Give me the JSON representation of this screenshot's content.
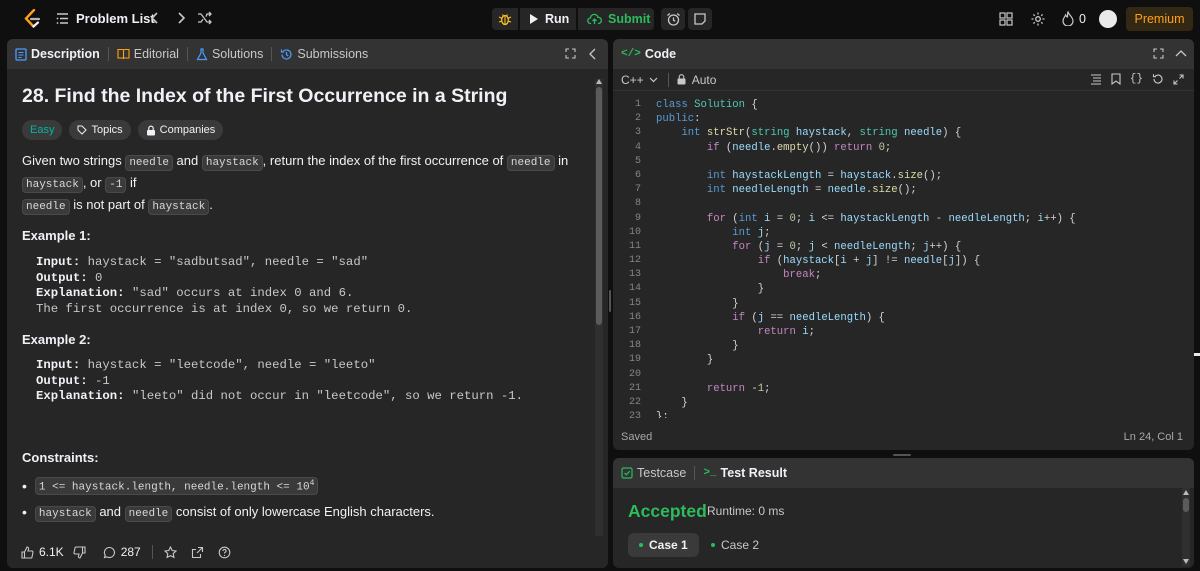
{
  "topbar": {
    "problem_list": "Problem List",
    "run": "Run",
    "submit": "Submit",
    "streak_count": "0",
    "premium": "Premium"
  },
  "left_tabs": {
    "description": "Description",
    "editorial": "Editorial",
    "solutions": "Solutions",
    "submissions": "Submissions"
  },
  "problem": {
    "title": "28. Find the Index of the First Occurrence in a String",
    "difficulty": "Easy",
    "topics": "Topics",
    "companies": "Companies",
    "desc_1": "Given two strings ",
    "needle": "needle",
    "and": " and ",
    "haystack": "haystack",
    "desc_2": ", return the index of the first occurrence of ",
    "in": " in ",
    "or": ", or ",
    "neg1": "-1",
    "if": " if",
    "is_not_part_of": " is not part of ",
    "period": ".",
    "example1_title": "Example 1:",
    "ex1_input_label": "Input:",
    "ex1_input": " haystack = \"sadbutsad\", needle = \"sad\"",
    "ex1_output_label": "Output:",
    "ex1_output": " 0",
    "ex1_expl_label": "Explanation:",
    "ex1_expl_1": " \"sad\" occurs at index 0 and 6.",
    "ex1_expl_2": "The first occurrence is at index 0, so we return 0.",
    "example2_title": "Example 2:",
    "ex2_input_label": "Input:",
    "ex2_input": " haystack = \"leetcode\", needle = \"leeto\"",
    "ex2_output_label": "Output:",
    "ex2_output": " -1",
    "ex2_expl_label": "Explanation:",
    "ex2_expl": " \"leeto\" did not occur in \"leetcode\", so we return -1.",
    "constraints_title": "Constraints:",
    "constraint_1_code": "1 <= haystack.length, needle.length <= 10",
    "constraint_1_sup": "4",
    "constraint_2_a": "haystack",
    "constraint_2_and": " and ",
    "constraint_2_b": "needle",
    "constraint_2_rest": " consist of only lowercase English characters."
  },
  "footer": {
    "likes": "6.1K",
    "comments": "287"
  },
  "code_panel": {
    "title": "Code",
    "language": "C++",
    "auto": "Auto",
    "saved": "Saved",
    "cursor": "Ln 24, Col 1",
    "line_numbers": [
      "1",
      "2",
      "3",
      "4",
      "5",
      "6",
      "7",
      "8",
      "9",
      "10",
      "11",
      "12",
      "13",
      "14",
      "15",
      "16",
      "17",
      "18",
      "19",
      "20",
      "21",
      "22",
      "23"
    ]
  },
  "result_panel": {
    "testcase": "Testcase",
    "test_result": "Test Result",
    "accepted": "Accepted",
    "runtime": "Runtime: 0 ms",
    "case1": "Case 1",
    "case2": "Case 2"
  },
  "colors": {
    "accent_green": "#2cbb5d",
    "accent_orange": "#ffa116",
    "easy_teal": "#00b8a3"
  }
}
